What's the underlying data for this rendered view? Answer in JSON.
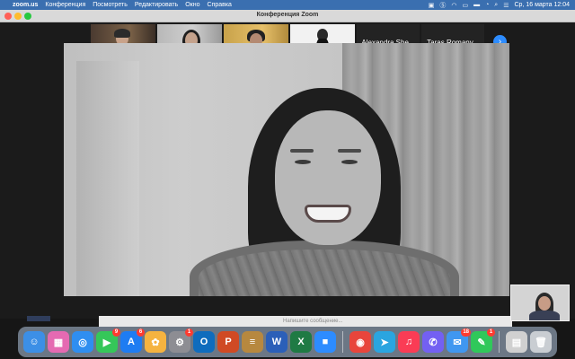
{
  "menubar": {
    "app_name": "zoom.us",
    "menus": [
      "Конференция",
      "Посмотреть",
      "Редактировать",
      "Окно",
      "Справка"
    ],
    "clock": "Ср, 16 марта  12:04"
  },
  "window": {
    "title": "Конференция Zoom"
  },
  "gallery": {
    "participants": [
      {
        "type": "video"
      },
      {
        "type": "video",
        "active": true
      },
      {
        "type": "video"
      },
      {
        "type": "video"
      },
      {
        "type": "name",
        "name": "Alexandra She..."
      },
      {
        "type": "name",
        "name": "Taras Romany..."
      }
    ]
  },
  "chat_behind": {
    "placeholder": "Напишите сообщение..."
  },
  "dock": {
    "apps": [
      {
        "icon": "finder-icon",
        "color": "#3c8fe6",
        "glyph": "☺"
      },
      {
        "icon": "launchpad-icon",
        "color": "#e56ab2",
        "glyph": "▦"
      },
      {
        "icon": "safari-icon",
        "color": "#2f8ef0",
        "glyph": "◎"
      },
      {
        "icon": "facetime-icon",
        "color": "#35c759",
        "glyph": "▶",
        "badge": "9"
      },
      {
        "icon": "app-store-icon",
        "color": "#1e7cf2",
        "glyph": "A",
        "badge": "6"
      },
      {
        "icon": "photos-icon",
        "color": "#f5b340",
        "glyph": "✿"
      },
      {
        "icon": "system-preferences-icon",
        "color": "#8d8d93",
        "glyph": "⚙",
        "badge": "1"
      },
      {
        "icon": "outlook-icon",
        "color": "#0f6cbd",
        "glyph": "O"
      },
      {
        "icon": "powerpoint-icon",
        "color": "#d04a24",
        "glyph": "P"
      },
      {
        "icon": "notes-icon",
        "color": "#b7883f",
        "glyph": "≡"
      },
      {
        "icon": "word-icon",
        "color": "#2b5fb8",
        "glyph": "W"
      },
      {
        "icon": "excel-icon",
        "color": "#1f7a44",
        "glyph": "X"
      },
      {
        "icon": "zoom-icon",
        "color": "#2d8cff",
        "glyph": "■"
      },
      {
        "sep": true
      },
      {
        "icon": "chrome-icon",
        "color": "#e8453c",
        "glyph": "◉"
      },
      {
        "icon": "telegram-icon",
        "color": "#2aa5e0",
        "glyph": "➤"
      },
      {
        "icon": "music-icon",
        "color": "#fa3c55",
        "glyph": "♫"
      },
      {
        "icon": "viber-icon",
        "color": "#7360f2",
        "glyph": "✆"
      },
      {
        "icon": "mail-icon",
        "color": "#3f97f0",
        "glyph": "✉",
        "badge": "18"
      },
      {
        "icon": "messages-icon",
        "color": "#30c85a",
        "glyph": "✎",
        "badge": "1"
      },
      {
        "sep": true
      },
      {
        "icon": "document-icon",
        "color": "#d0d0d0",
        "glyph": "▤"
      },
      {
        "icon": "trash-icon",
        "color": "#c9cdd2",
        "glyph": "🗑"
      }
    ]
  }
}
